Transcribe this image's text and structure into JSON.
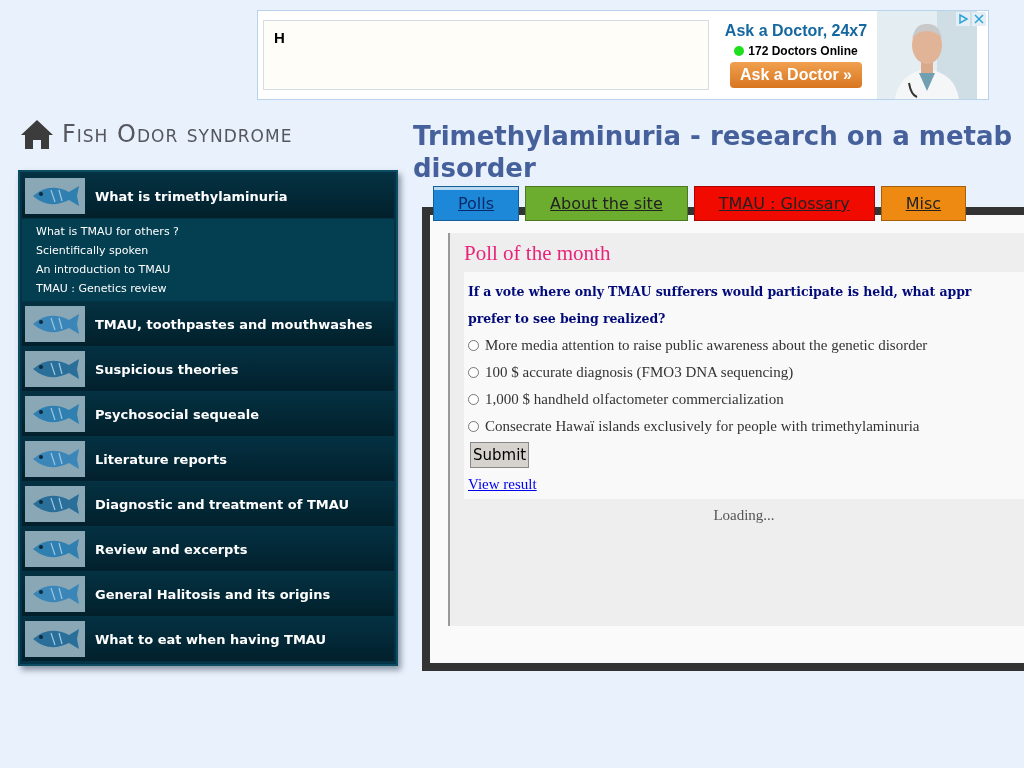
{
  "ad": {
    "field_value": "H",
    "headline": "Ask a Doctor, 24x7",
    "online_count": "172 Doctors Online",
    "button": "Ask a Doctor »"
  },
  "site_title": "Fish Odor syndrome",
  "sidebar": {
    "items": [
      {
        "label": "What is trimethylaminuria",
        "children": [
          {
            "label": "What is TMAU for others ?"
          },
          {
            "label": "Scientifically spoken"
          },
          {
            "label": "An introduction to TMAU"
          },
          {
            "label": "TMAU : Genetics review"
          }
        ]
      },
      {
        "label": "TMAU, toothpastes and mouthwashes"
      },
      {
        "label": "Suspicious theories"
      },
      {
        "label": "Psychosocial sequeale"
      },
      {
        "label": "Literature reports"
      },
      {
        "label": "Diagnostic and treatment of TMAU"
      },
      {
        "label": "Review and excerpts"
      },
      {
        "label": "General Halitosis and its origins"
      },
      {
        "label": "What to eat when having TMAU"
      }
    ]
  },
  "page_title_lines": [
    "Trimethylaminuria - research on a metab",
    "disorder"
  ],
  "tabs": [
    {
      "label": "Polls",
      "selected": true,
      "color": "#1e88d8"
    },
    {
      "label": "About the site",
      "selected": false,
      "color": "#6cac2e"
    },
    {
      "label": "TMAU : Glossary",
      "selected": false,
      "color": "#f00a00"
    },
    {
      "label": "Misc",
      "selected": false,
      "color": "#ee8a12"
    }
  ],
  "poll": {
    "title": "Poll of the month",
    "question_lines": [
      "If a vote where only TMAU sufferers would participate is held, what appr",
      "prefer to see being realized?"
    ],
    "options": [
      {
        "label": "More media attention to raise public awareness about the genetic disorder",
        "selected": false
      },
      {
        "label": "100 $ accurate diagnosis (FMO3 DNA sequencing)",
        "selected": false
      },
      {
        "label": "1,000 $ handheld olfactometer commercialization",
        "selected": false
      },
      {
        "label": "Consecrate Hawaï islands exclusively for people with trimethylaminuria",
        "selected": false
      }
    ],
    "submit": "Submit",
    "view_result": "View result",
    "loading": "Loading..."
  }
}
